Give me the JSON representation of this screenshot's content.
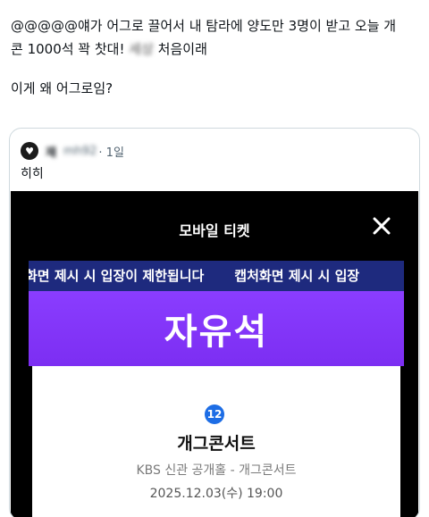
{
  "post": {
    "line1": "@@@@@얘가 어그로 끌어서 내 탐라에 양도만 3명이 받고 오늘 개",
    "line2_start": "콘 1000석 꽉 찻대!",
    "line2_blurred": "세상",
    "line2_end": "처음이래",
    "line3": "이게 왜 어그로임?"
  },
  "quoted_post": {
    "avatar_glyph": "♥",
    "name": "재",
    "handle": "mh92",
    "time": "· 1일",
    "text": "히히"
  },
  "ticket": {
    "title": "모바일 티켓",
    "marquee": [
      "화면 제시 시 입장이 제한됩니다",
      "캡처화면 제시 시 입장"
    ],
    "seat": "자유석",
    "number": "12",
    "show_title": "개그콘서트",
    "venue": "KBS 신관 공개홀 - 개그콘서트",
    "datetime": "2025.12.03(수) 19:00"
  },
  "colors": {
    "seat_band": "#8a3dff",
    "marquee_bg": "#1e2a7e",
    "number_badge": "#1d6de5"
  },
  "icons": {
    "close": "close-icon",
    "avatar": "heart-icon"
  }
}
